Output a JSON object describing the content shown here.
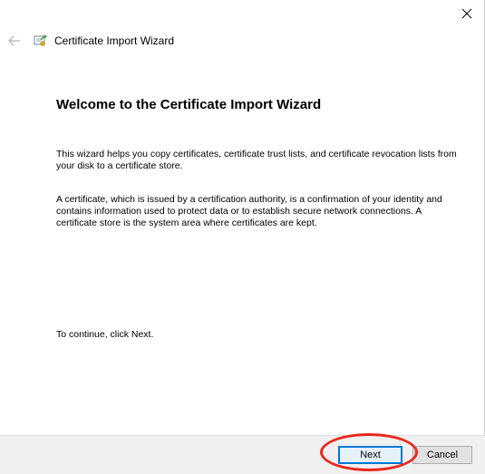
{
  "window": {
    "close_icon": "close-icon"
  },
  "header": {
    "back_icon": "back-arrow-icon",
    "wizard_icon": "certificate-icon",
    "title": "Certificate Import Wizard"
  },
  "content": {
    "heading": "Welcome to the Certificate Import Wizard",
    "paragraph1": "This wizard helps you copy certificates, certificate trust lists, and certificate revocation lists from your disk to a certificate store.",
    "paragraph2": "A certificate, which is issued by a certification authority, is a confirmation of your identity and contains information used to protect data or to establish secure network connections. A certificate store is the system area where certificates are kept.",
    "paragraph3": "To continue, click Next."
  },
  "footer": {
    "next_label": "Next",
    "cancel_label": "Cancel"
  },
  "colors": {
    "highlight_ring": "#e8281e",
    "default_button_border": "#0078d7"
  }
}
